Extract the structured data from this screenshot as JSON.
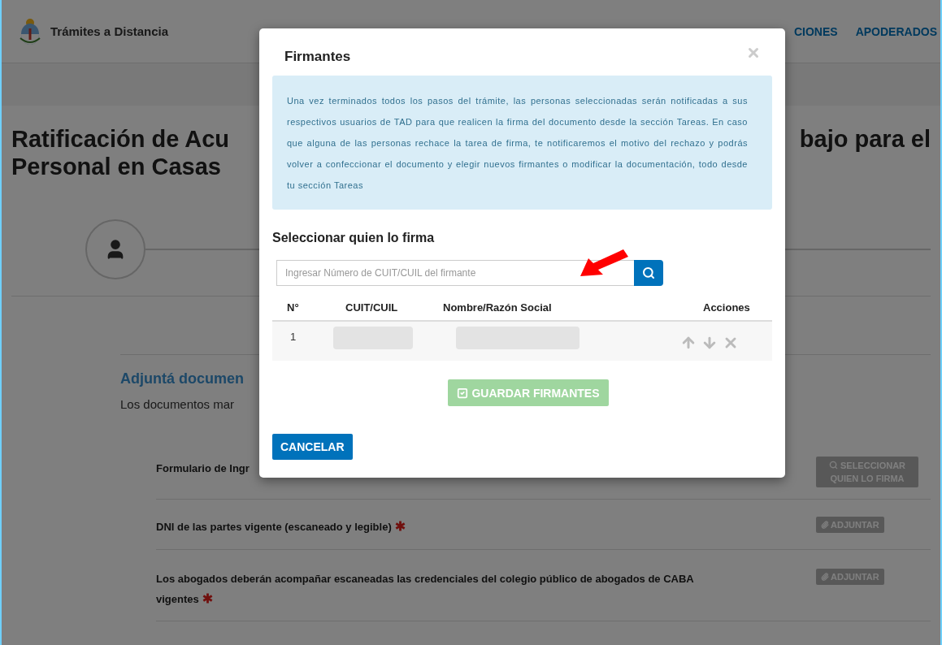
{
  "header": {
    "brand": "Trámites a Distancia",
    "nav": [
      {
        "label": "CIONES"
      },
      {
        "label": "APODERADOS"
      }
    ]
  },
  "page": {
    "title_left": [
      "Ratificación de Acu",
      "Personal en Casas"
    ],
    "title_right": "bajo para el",
    "section_title": "Adjuntá documen",
    "section_note": "Los documentos mar",
    "documents": [
      {
        "label": "Formulario de Ingr",
        "required": false,
        "action": {
          "kind": "select",
          "label": "SELECCIONAR QUIEN LO FIRMA"
        }
      },
      {
        "label": "DNI de las partes vigente (escaneado y legible)",
        "required": true,
        "action": {
          "kind": "attach",
          "label": "ADJUNTAR"
        }
      },
      {
        "label": "Los abogados deberán acompañar escaneadas las credenciales del colegio público de abogados de CABA vigentes",
        "required": true,
        "action": {
          "kind": "attach",
          "label": "ADJUNTAR"
        }
      }
    ]
  },
  "modal": {
    "title": "Firmantes",
    "info": "Una vez terminados todos los pasos del trámite, las personas seleccionadas serán notificadas a sus respectivos usuarios de TAD para que realicen la firma del documento desde la sección Tareas. En caso que alguna de las personas rechace la tarea de firma, te notificaremos el motivo del rechazo y podrás volver a confeccionar el documento y elegir nuevos firmantes o modificar la documentación, todo desde tu sección Tareas",
    "subtitle": "Seleccionar quien lo firma",
    "search": {
      "placeholder": "Ingresar Número de CUIT/CUIL del firmante"
    },
    "columns": [
      "N°",
      "CUIT/CUIL",
      "Nombre/Razón Social",
      "Acciones"
    ],
    "rows": [
      {
        "number": "1"
      }
    ],
    "save_button": {
      "label": "GUARDAR FIRMANTES",
      "disabled": true
    },
    "cancel_button": {
      "label": "CANCELAR"
    }
  }
}
